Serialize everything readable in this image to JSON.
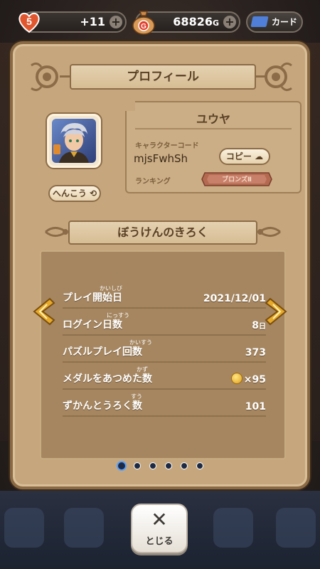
{
  "topbar": {
    "hearts_level": "5",
    "hearts_value": "+11",
    "gold_value": "68826",
    "gold_unit": "G",
    "card_label": "カード"
  },
  "profile": {
    "title": "プロフィール",
    "change_button": "へんこう",
    "name": "ユウヤ",
    "character_code_label": "キャラクターコード",
    "character_code": "mjsFwhSh",
    "copy_button": "コピー",
    "ranking_label": "ランキング",
    "ranking_value": "ブロンズⅡ"
  },
  "records": {
    "title": "ぼうけんのきろく",
    "rows": [
      {
        "label": "プレイ開始日",
        "ruby": "かいしび",
        "value": "2021/12/01",
        "unit": ""
      },
      {
        "label": "ログイン日数",
        "ruby": "にっすう",
        "value": "8",
        "unit": "日"
      },
      {
        "label": "パズルプレイ回数",
        "ruby": "かいすう",
        "value": "373",
        "unit": ""
      },
      {
        "label": "メダルをあつめた数",
        "ruby": "かず",
        "value": "×95",
        "unit": ""
      },
      {
        "label": "ずかんとうろく数",
        "ruby": "すう",
        "value": "101",
        "unit": ""
      }
    ]
  },
  "pagination": {
    "total": 6,
    "active": 1
  },
  "close": {
    "icon": "✕",
    "label": "とじる"
  },
  "colors": {
    "panel": "#c6a77d",
    "records_bg": "#a58660",
    "accent_gold": "#e6a92a"
  }
}
